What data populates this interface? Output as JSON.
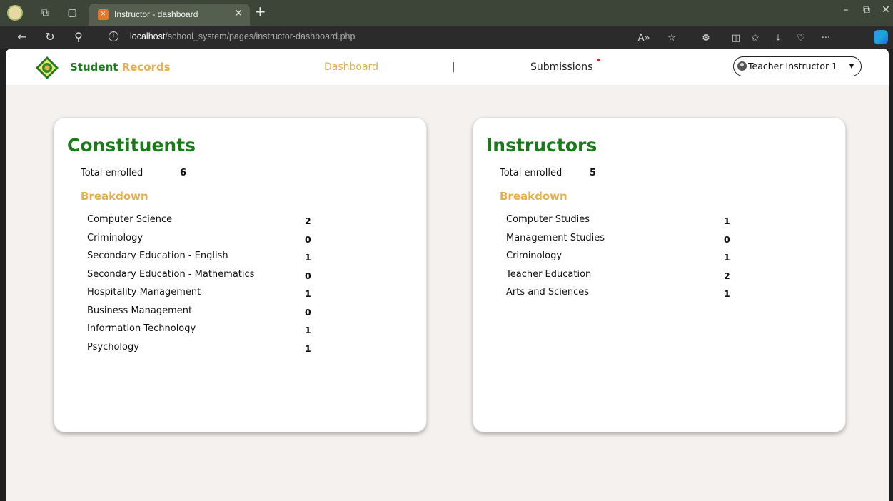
{
  "browser": {
    "tab_title": "Instructor - dashboard",
    "tab_favicon": "xampp-icon",
    "url_host": "localhost",
    "url_path": "/school_system/pages/instructor-dashboard.php",
    "colors": {
      "tabbar": "#3c4538",
      "address_bar": "#2b2b2b"
    }
  },
  "nav": {
    "brand_primary": "Student",
    "brand_secondary": "Records",
    "dashboard_link": "Dashboard",
    "separator": "|",
    "submissions_link": "Submissions",
    "user_name": "Teacher Instructor 1"
  },
  "constituents": {
    "title": "Constituents",
    "total_label": "Total enrolled",
    "total_value": "6",
    "breakdown_label": "Breakdown",
    "items": [
      {
        "label": "Computer Science",
        "value": "2"
      },
      {
        "label": "Criminology",
        "value": "0"
      },
      {
        "label": "Secondary Education - English",
        "value": "1"
      },
      {
        "label": "Secondary Education - Mathematics",
        "value": "0"
      },
      {
        "label": "Hospitality Management",
        "value": "1"
      },
      {
        "label": "Business Management",
        "value": "0"
      },
      {
        "label": "Information Technology",
        "value": "1"
      },
      {
        "label": "Psychology",
        "value": "1"
      }
    ]
  },
  "instructors": {
    "title": "Instructors",
    "total_label": "Total enrolled",
    "total_value": "5",
    "breakdown_label": "Breakdown",
    "items": [
      {
        "label": "Computer Studies",
        "value": "1"
      },
      {
        "label": "Management Studies",
        "value": "0"
      },
      {
        "label": "Criminology",
        "value": "1"
      },
      {
        "label": "Teacher Education",
        "value": "2"
      },
      {
        "label": "Arts and Sciences",
        "value": "1"
      }
    ]
  },
  "colors": {
    "brand_green": "#1e7a1e",
    "accent_gold": "#e2b04c",
    "page_background": "#f5f1ef",
    "notification_dot": "#e01818"
  }
}
